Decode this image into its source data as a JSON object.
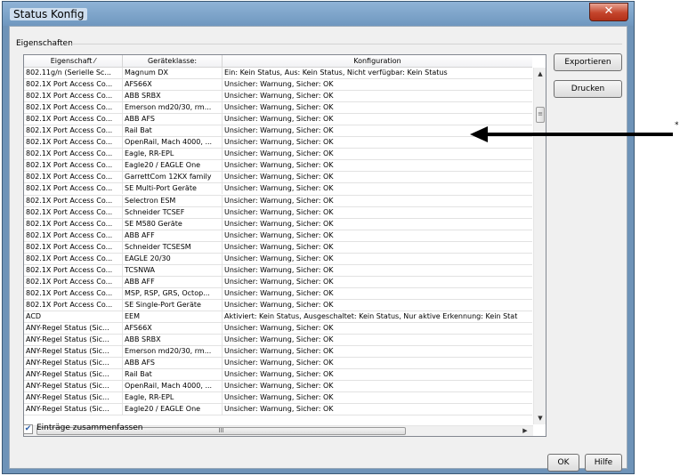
{
  "window": {
    "title": "Status Konfig",
    "close_glyph": "✕"
  },
  "group": {
    "label": "Eigenschaften"
  },
  "grid": {
    "columns": [
      "Eigenschaft ⁄​",
      "Geräteklasse:",
      "Konfiguration"
    ],
    "rows": [
      [
        "802.11g/n (Serielle Sc...",
        "Magnum DX",
        "Ein: Kein Status, Aus: Kein Status, Nicht verfügbar: Kein Status"
      ],
      [
        "802.1X Port Access Co...",
        "AFS66X",
        "Unsicher: Warnung, Sicher: OK"
      ],
      [
        "802.1X Port Access Co...",
        "ABB SRBX",
        "Unsicher: Warnung, Sicher: OK"
      ],
      [
        "802.1X Port Access Co...",
        "Emerson md20/30, rm...",
        "Unsicher: Warnung, Sicher: OK"
      ],
      [
        "802.1X Port Access Co...",
        "ABB AFS",
        "Unsicher: Warnung, Sicher: OK"
      ],
      [
        "802.1X Port Access Co...",
        "Rail Bat",
        "Unsicher: Warnung, Sicher: OK"
      ],
      [
        "802.1X Port Access Co...",
        "OpenRail, Mach 4000, ...",
        "Unsicher: Warnung, Sicher: OK"
      ],
      [
        "802.1X Port Access Co...",
        "Eagle, RR-EPL",
        "Unsicher: Warnung, Sicher: OK"
      ],
      [
        "802.1X Port Access Co...",
        "Eagle20 / EAGLE One",
        "Unsicher: Warnung, Sicher: OK"
      ],
      [
        "802.1X Port Access Co...",
        "GarrettCom 12KX family",
        "Unsicher: Warnung, Sicher: OK"
      ],
      [
        "802.1X Port Access Co...",
        "SE Multi-Port Geräte",
        "Unsicher: Warnung, Sicher: OK"
      ],
      [
        "802.1X Port Access Co...",
        "Selectron ESM",
        "Unsicher: Warnung, Sicher: OK"
      ],
      [
        "802.1X Port Access Co...",
        "Schneider TCSEF",
        "Unsicher: Warnung, Sicher: OK"
      ],
      [
        "802.1X Port Access Co...",
        "SE M580 Geräte",
        "Unsicher: Warnung, Sicher: OK"
      ],
      [
        "802.1X Port Access Co...",
        "ABB AFF",
        "Unsicher: Warnung, Sicher: OK"
      ],
      [
        "802.1X Port Access Co...",
        "Schneider TCSESM",
        "Unsicher: Warnung, Sicher: OK"
      ],
      [
        "802.1X Port Access Co...",
        "EAGLE 20/30",
        "Unsicher: Warnung, Sicher: OK"
      ],
      [
        "802.1X Port Access Co...",
        "TCSNWA",
        "Unsicher: Warnung, Sicher: OK"
      ],
      [
        "802.1X Port Access Co...",
        "ABB AFF",
        "Unsicher: Warnung, Sicher: OK"
      ],
      [
        "802.1X Port Access Co...",
        "MSP, RSP, GRS, Octop...",
        "Unsicher: Warnung, Sicher: OK"
      ],
      [
        "802.1X Port Access Co...",
        "SE Single-Port Geräte",
        "Unsicher: Warnung, Sicher: OK"
      ],
      [
        "ACD",
        "EEM",
        "Aktiviert: Kein Status, Ausgeschaltet: Kein Status, Nur aktive Erkennung: Kein Stat"
      ],
      [
        "ANY-Regel Status (Sic...",
        "AFS66X",
        "Unsicher: Warnung, Sicher: OK"
      ],
      [
        "ANY-Regel Status (Sic...",
        "ABB SRBX",
        "Unsicher: Warnung, Sicher: OK"
      ],
      [
        "ANY-Regel Status (Sic...",
        "Emerson md20/30, rm...",
        "Unsicher: Warnung, Sicher: OK"
      ],
      [
        "ANY-Regel Status (Sic...",
        "ABB AFS",
        "Unsicher: Warnung, Sicher: OK"
      ],
      [
        "ANY-Regel Status (Sic...",
        "Rail Bat",
        "Unsicher: Warnung, Sicher: OK"
      ],
      [
        "ANY-Regel Status (Sic...",
        "OpenRail, Mach 4000, ...",
        "Unsicher: Warnung, Sicher: OK"
      ],
      [
        "ANY-Regel Status (Sic...",
        "Eagle, RR-EPL",
        "Unsicher: Warnung, Sicher: OK"
      ],
      [
        "ANY-Regel Status (Sic...",
        "Eagle20 / EAGLE One",
        "Unsicher: Warnung, Sicher: OK"
      ]
    ]
  },
  "scroll": {
    "up": "▲",
    "down": "▼",
    "left": "◀",
    "right": "▶",
    "grip": "≡",
    "hgrip": "III"
  },
  "buttons": {
    "export": "Exportieren",
    "print": "Drucken",
    "ok": "OK",
    "help": "Hilfe"
  },
  "checkbox": {
    "label": "Einträge zusammenfassen",
    "checked": true,
    "mark": "✔"
  },
  "annotation": {
    "marker": "*"
  },
  "colors": {
    "frame": "#6e93b8",
    "client": "#f0f0f0",
    "close": "#c4452c"
  }
}
